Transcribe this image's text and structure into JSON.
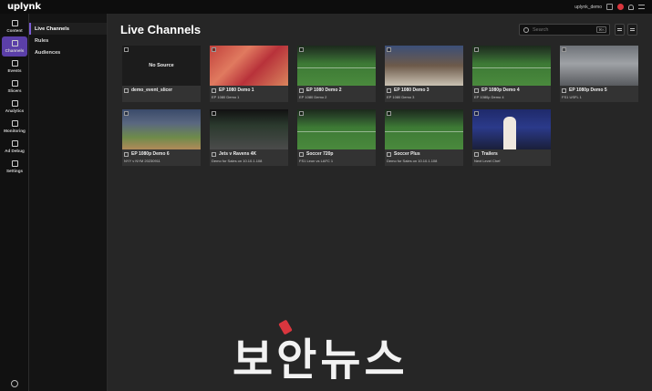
{
  "app": {
    "logo": "uplynk",
    "user_name": "uplynk_demo"
  },
  "rail": [
    {
      "label": "Content",
      "icon": "document-icon"
    },
    {
      "label": "Channels",
      "icon": "channels-icon",
      "active": true
    },
    {
      "label": "Events",
      "icon": "events-icon"
    },
    {
      "label": "Slicers",
      "icon": "slicer-icon"
    },
    {
      "label": "Analytics",
      "icon": "analytics-icon"
    },
    {
      "label": "Monitoring",
      "icon": "monitoring-icon"
    },
    {
      "label": "Ad Debug",
      "icon": "ad-debug-icon"
    },
    {
      "label": "Settings",
      "icon": "gear-icon"
    }
  ],
  "subnav": [
    {
      "label": "Live Channels",
      "active": true
    },
    {
      "label": "Rules"
    },
    {
      "label": "Audiences"
    }
  ],
  "page": {
    "title": "Live Channels"
  },
  "search": {
    "placeholder": "Search",
    "shortcut": "⌘K"
  },
  "no_source_label": "No Source",
  "channels": [
    {
      "title": "demo_event_slicer",
      "subtitle": "",
      "scene": "none"
    },
    {
      "title": "EP 1080 Demo 1",
      "subtitle": "EP 1080 Demo 1",
      "scene": "crowd"
    },
    {
      "title": "EP 1080 Demo 2",
      "subtitle": "EP 1080 Demo 2",
      "scene": "pitch"
    },
    {
      "title": "EP 1080 Demo 3",
      "subtitle": "EP 1080 Demo 3",
      "scene": "studio"
    },
    {
      "title": "EP 1080p Demo 4",
      "subtitle": "EP 1080p Demo 4",
      "scene": "pitch"
    },
    {
      "title": "EP 1080p Demo 5",
      "subtitle": "FS1 USFL 1",
      "scene": "office"
    },
    {
      "title": "EP 1080p Demo 6",
      "subtitle": "NYY v NYM 20230911",
      "scene": "baseball"
    },
    {
      "title": "Jets v Ravens 4K",
      "subtitle": "Demo for Sales on 10.10.1.108",
      "scene": "desk"
    },
    {
      "title": "Soccer 720p",
      "subtitle": "FS1 Leon vs LAFC 1",
      "scene": "pitch"
    },
    {
      "title": "Soccer Plus",
      "subtitle": "Demo for Sales on 10.10.1.108",
      "scene": "pitch"
    },
    {
      "title": "Trailers",
      "subtitle": "Next Level Chef",
      "scene": "chef"
    }
  ],
  "watermark": "보안뉴스"
}
